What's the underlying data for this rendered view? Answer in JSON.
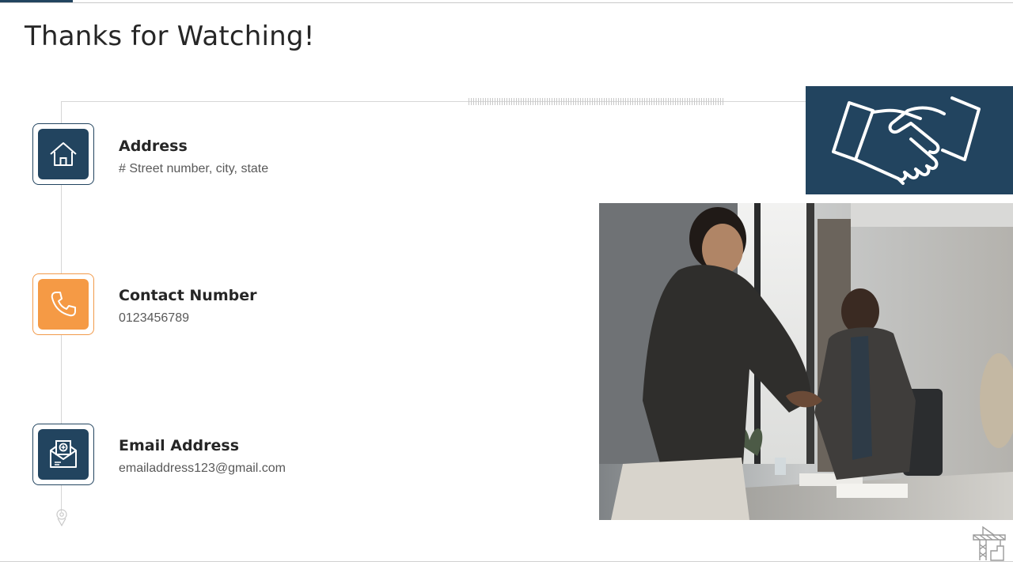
{
  "slide": {
    "title": "Thanks for Watching!"
  },
  "contacts": [
    {
      "title": "Address",
      "value": "# Street number, city, state",
      "icon": "house-icon"
    },
    {
      "title": "Contact Number",
      "value": "0123456789",
      "icon": "phone-icon"
    },
    {
      "title": "Email Address",
      "value": "emailaddress123@gmail.com",
      "icon": "envelope-icon"
    }
  ],
  "decor": {
    "banner_icon": "handshake-icon",
    "photo": "handshake-photo",
    "corner_logo": "crane-logo-icon"
  },
  "colors": {
    "navy": "#22445f",
    "orange": "#f59a45",
    "text_dark": "#262626",
    "text_gray": "#595959"
  }
}
